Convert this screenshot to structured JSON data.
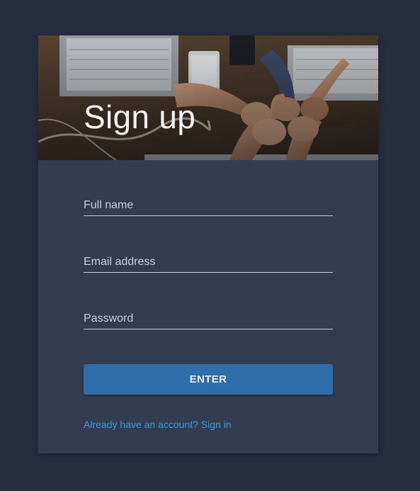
{
  "form": {
    "title": "Sign up",
    "fields": [
      {
        "placeholder": "Full name",
        "type": "text"
      },
      {
        "placeholder": "Email address",
        "type": "email"
      },
      {
        "placeholder": "Password",
        "type": "password"
      }
    ],
    "submit_label": "ENTER",
    "signin_link": "Already have an account? Sign in"
  },
  "colors": {
    "page_background": "#262d3e",
    "card_background": "#323d52",
    "button": "#2f6eaa",
    "link": "#2f9fe0"
  },
  "hero_image": {
    "subject": "hands-fist-bump-over-laptops-photo"
  }
}
